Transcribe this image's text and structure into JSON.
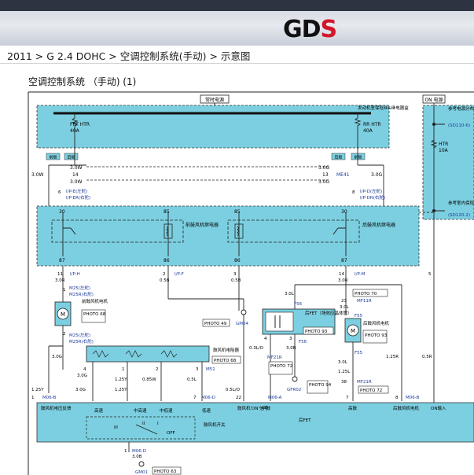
{
  "header": {
    "logo_text": "GDS",
    "logo_main": "GD",
    "logo_accent": "S",
    "accent_color": "#d3162a"
  },
  "breadcrumb": {
    "text": "2011 > G 2.4 DOHC > 空调控制系统(手动) > 示意图"
  },
  "diagram": {
    "title": "空调控制系统 （手动) (1)",
    "fuse_box": {
      "label_hot": "常时电源",
      "label_on": "ON 电源",
      "engine_room_box": "发动机室保险丝&继电器盒",
      "frt_htr": "FRT HTR",
      "frt_amp": "40A",
      "rr_htr": "RR HTR",
      "rr_amp": "40A",
      "htr": "HTR",
      "htr_amp": "10A",
      "ref1": "参考电源分布",
      "ref1_code": "(SD110-6)",
      "ref2": "参考室内保险丝分布",
      "ref2_code": "(SD120-2)"
    },
    "tags": {
      "front": "前舱",
      "rear": "后舱"
    },
    "wires": {
      "w30": "3.0W",
      "w3w": "3.0W",
      "n10": "10",
      "n14": "14",
      "n3": "3",
      "w3g": "3.0G",
      "n13": "13",
      "n7": "7",
      "me41": "ME41",
      "ipe": "I/P-E(左舵)",
      "ipe2": "I/P-ER(右舵)",
      "n6": "6",
      "ipd": "I/P-D(左舵)",
      "ipd2": "I/P-DR(右舵)",
      "n8": "8"
    },
    "relays": {
      "front": "前鼓风机继电器",
      "rear": "后鼓风机继电器",
      "p30a": "30",
      "p85a": "85",
      "p87a": "87",
      "p86a": "86",
      "p85b": "85",
      "p30b": "30",
      "p86b": "86",
      "p87b": "87"
    },
    "lower": {
      "n11": "11",
      "iph": "I/P-H",
      "r30": "3.0R",
      "n2": "2",
      "ipf": "I/P-F",
      "b05a": "0.5B",
      "n3b": "3",
      "b05b": "0.5B",
      "n14b": "14",
      "ipm": "I/P-M",
      "n5": "5",
      "m25": "M25(左舵)",
      "m25r": "M25R(右舵)",
      "n1": "1",
      "front_motor": "前鼓风机电机",
      "photo68": "PHOTO 68",
      "motor_m": "M",
      "n2b": "2",
      "photo49": "PHOTO 49",
      "gm04": "GM04",
      "photo70": "PHOTO 70",
      "f56": "F56",
      "mf11r": "MF11R",
      "n23": "23",
      "l30": "3.0L",
      "r30b": "3.0R",
      "fet": "后FET（场效应晶体管）",
      "photo93": "PHOTO 93",
      "f55": "F55",
      "rear_motor": "后鼓风机电机",
      "n4": "4",
      "n3c": "3",
      "lo03": "0.3L/O",
      "b30": "3.0B",
      "mf21r": "MF21R",
      "photo72": "PHOTO 72",
      "photo94": "PHOTO 94",
      "gfr02": "GFR02",
      "l125": "1.25L",
      "n38": "38",
      "n5b": "5",
      "r125": "1.25R",
      "r05": "0.5R",
      "n8b": "8",
      "resistor": "鼓风机电阻器",
      "photo68b": "PHOTO 68",
      "g30": "3.0G",
      "n4c": "4",
      "n1c": "1",
      "n2c": "2",
      "n3d": "3",
      "y125": "1.25Y",
      "w085": "0.85W",
      "l05": "0.5L",
      "m51": "M51",
      "lo05": "0.5L/O",
      "n22": "22",
      "m06d": "M06-D",
      "n7b": "7",
      "m06a": "M06-A",
      "m06b": "M06-B",
      "n1d": "1"
    },
    "control": {
      "feedback": "鼓风机电压反馈",
      "high": "高速",
      "mid_high": "中高速",
      "mid_low": "中低速",
      "low": "低速",
      "switch": "鼓风机开关",
      "on_signal": "鼓风机'ON'信号",
      "mid": "中鼓",
      "rear_fet": "后FET",
      "hi_low": "高鼓",
      "rear_motor": "后鼓风机电机",
      "on_input": "ON输入",
      "iii": "III",
      "ii": "II",
      "i": "I",
      "off": "OFF"
    },
    "ground": {
      "m06d": "M06-D",
      "n1": "1",
      "b30": "3.0B",
      "gm01": "GM01",
      "photo63": "PHOTO 63"
    }
  }
}
